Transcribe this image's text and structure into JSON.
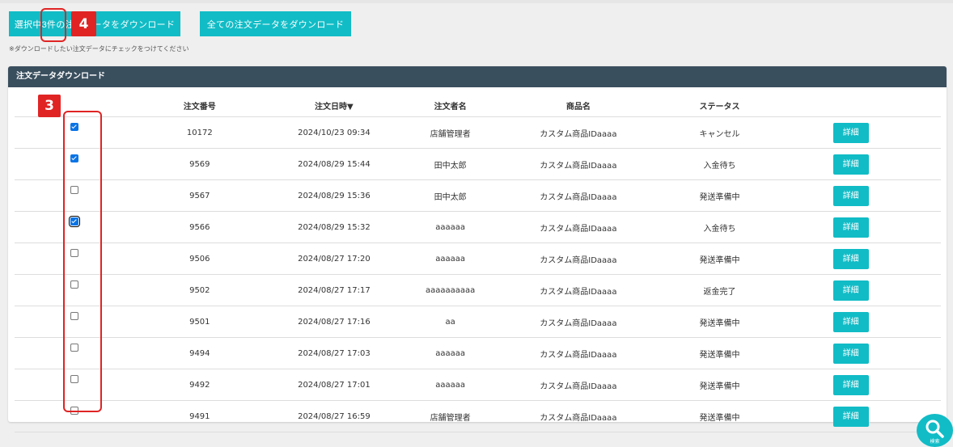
{
  "toolbar": {
    "download_selected_label": "選択中3件の注文データをダウンロード",
    "download_all_label": "全ての注文データをダウンロード",
    "hint": "※ダウンロードしたい注文データにチェックをつけてください"
  },
  "panel": {
    "title": "注文データダウンロード",
    "columns": [
      "",
      "注文番号",
      "注文日時▼",
      "注文者名",
      "商品名",
      "ステータス",
      ""
    ],
    "detail_label": "詳細",
    "rows": [
      {
        "checked": true,
        "order_no": "10172",
        "date": "2024/10/23 09:34",
        "customer": "店舗管理者",
        "product": "カスタム商品IDaaaa",
        "status": "キャンセル"
      },
      {
        "checked": true,
        "order_no": "9569",
        "date": "2024/08/29 15:44",
        "customer": "田中太郎",
        "product": "カスタム商品IDaaaa",
        "status": "入金待ち"
      },
      {
        "checked": false,
        "order_no": "9567",
        "date": "2024/08/29 15:36",
        "customer": "田中太郎",
        "product": "カスタム商品IDaaaa",
        "status": "発送準備中"
      },
      {
        "checked": true,
        "order_no": "9566",
        "date": "2024/08/29 15:32",
        "customer": "aaaaaa",
        "product": "カスタム商品IDaaaa",
        "status": "入金待ち"
      },
      {
        "checked": false,
        "order_no": "9506",
        "date": "2024/08/27 17:20",
        "customer": "aaaaaa",
        "product": "カスタム商品IDaaaa",
        "status": "発送準備中"
      },
      {
        "checked": false,
        "order_no": "9502",
        "date": "2024/08/27 17:17",
        "customer": "aaaaaaaaaa",
        "product": "カスタム商品IDaaaa",
        "status": "返金完了"
      },
      {
        "checked": false,
        "order_no": "9501",
        "date": "2024/08/27 17:16",
        "customer": "aa",
        "product": "カスタム商品IDaaaa",
        "status": "発送準備中"
      },
      {
        "checked": false,
        "order_no": "9494",
        "date": "2024/08/27 17:03",
        "customer": "aaaaaa",
        "product": "カスタム商品IDaaaa",
        "status": "発送準備中"
      },
      {
        "checked": false,
        "order_no": "9492",
        "date": "2024/08/27 17:01",
        "customer": "aaaaaa",
        "product": "カスタム商品IDaaaa",
        "status": "発送準備中"
      },
      {
        "checked": false,
        "order_no": "9491",
        "date": "2024/08/27 16:59",
        "customer": "店舗管理者",
        "product": "カスタム商品IDaaaa",
        "status": "発送準備中"
      }
    ]
  },
  "annotations": {
    "badge_3": "3",
    "badge_4": "4"
  },
  "search_fab": {
    "label": "検索",
    "icon": "magnifier-icon"
  },
  "colors": {
    "accent": "#11bcc6",
    "panel_header": "#3a4f5e",
    "annotation_red": "#e02424",
    "checkbox_blue": "#0b74e5"
  }
}
